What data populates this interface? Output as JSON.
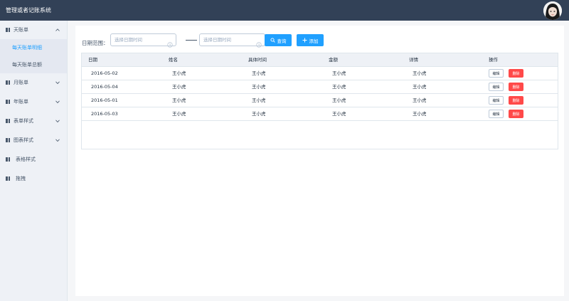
{
  "header": {
    "title": "管理或者记账系统"
  },
  "sidebar": {
    "groups": [
      {
        "label": "天账单",
        "expanded": true
      },
      {
        "label": "月账单",
        "expanded": false
      },
      {
        "label": "年账单",
        "expanded": false
      },
      {
        "label": "表单样式",
        "expanded": false
      },
      {
        "label": "图表样式",
        "expanded": false
      },
      {
        "label": "表格样式"
      },
      {
        "label": "拖拽"
      }
    ],
    "subitems": [
      {
        "label": "每天账单明细",
        "active": true
      },
      {
        "label": "每天账单总额",
        "active": false
      }
    ]
  },
  "filter": {
    "label": "日期范围：",
    "start_placeholder": "选择日期时间",
    "end_placeholder": "选择日期时间",
    "query_label": "查询",
    "add_label": "添加"
  },
  "table": {
    "columns": [
      "日期",
      "姓名",
      "具体时间",
      "金额",
      "详情",
      "操作"
    ],
    "rows": [
      {
        "date": "2016-05-02",
        "name": "王小虎",
        "time": "王小虎",
        "amount": "王小虎",
        "detail": "王小虎"
      },
      {
        "date": "2016-05-04",
        "name": "王小虎",
        "time": "王小虎",
        "amount": "王小虎",
        "detail": "王小虎"
      },
      {
        "date": "2016-05-01",
        "name": "王小虎",
        "time": "王小虎",
        "amount": "王小虎",
        "detail": "王小虎"
      },
      {
        "date": "2016-05-03",
        "name": "王小虎",
        "time": "王小虎",
        "amount": "王小虎",
        "detail": "王小虎"
      }
    ],
    "edit_label": "编辑",
    "delete_label": "删除"
  },
  "colors": {
    "header_bg": "#324157",
    "sidebar_bg": "#eef1f6",
    "submenu_bg": "#e4e8f1",
    "primary": "#20a0ff",
    "danger": "#ff4949",
    "border": "#dfe6ec",
    "text": "#1f2d3d",
    "muted_text": "#48576a"
  }
}
